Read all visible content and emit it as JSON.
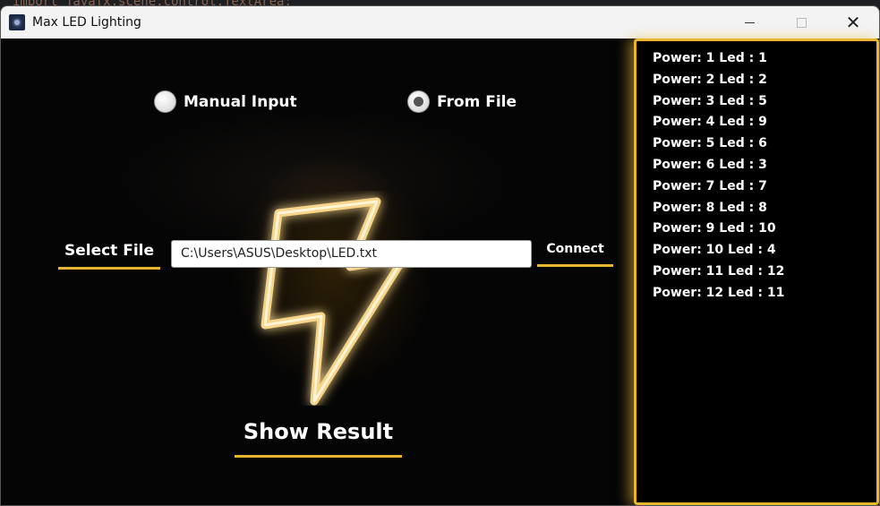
{
  "window": {
    "title": "Max LED Lighting",
    "minimize_icon": "minimize-icon",
    "maximize_icon": "maximize-icon",
    "close_icon": "close-icon"
  },
  "behind_code": "import javafx.scene.control.TextArea;",
  "input_mode": {
    "manual_label": "Manual Input",
    "file_label": "From File",
    "selected": "From File"
  },
  "file_row": {
    "select_label": "Select File",
    "path_value": "C:\\Users\\ASUS\\Desktop\\LED.txt",
    "connect_label": "Connect"
  },
  "show_result_label": "Show Result",
  "results": [
    "Power: 1 Led : 1",
    "Power: 2 Led : 2",
    "Power: 3 Led : 5",
    "Power: 4 Led : 9",
    "Power: 5 Led : 6",
    "Power: 6 Led : 3",
    "Power: 7 Led : 7",
    "Power: 8 Led : 8",
    "Power: 9 Led : 10",
    "Power: 10 Led : 4",
    "Power: 11 Led : 12",
    "Power: 12 Led : 11"
  ],
  "colors": {
    "accent": "#e8b62e",
    "background": "#000000",
    "text": "#ffffff"
  }
}
